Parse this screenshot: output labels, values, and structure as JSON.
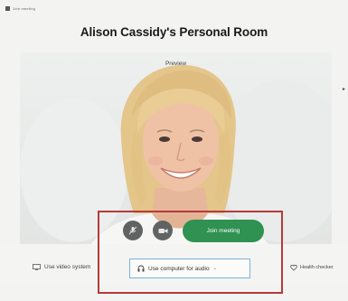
{
  "header": {
    "topbar_text": "Join meeting",
    "title": "Alison Cassidy's Personal Room"
  },
  "preview": {
    "label": "Preview"
  },
  "controls": {
    "mute_icon": "microphone-mute-icon",
    "video_icon": "camera-icon",
    "join_label": "Join meeting",
    "join_color": "#2f9152"
  },
  "options": {
    "video_label": "Use video system",
    "audio_label": "Use computer for audio",
    "health_label": "Health checker"
  },
  "colors": {
    "highlight_border": "#b53a3a",
    "select_border": "#7ab2d8"
  }
}
